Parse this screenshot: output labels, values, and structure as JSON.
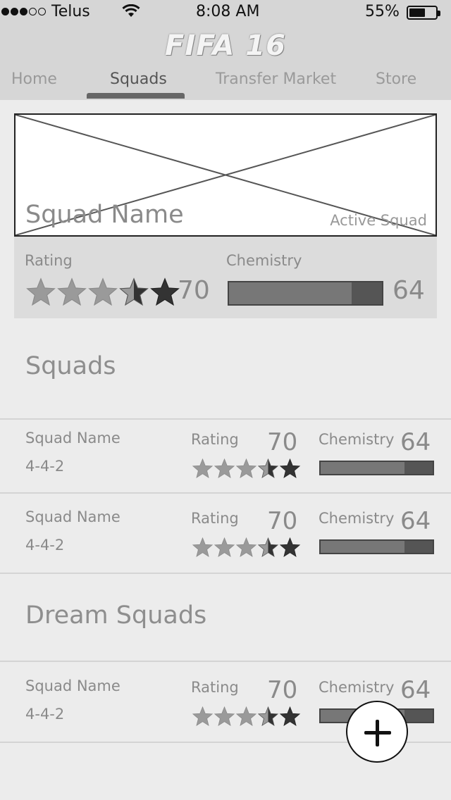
{
  "status_bar": {
    "carrier": "Telus",
    "time": "8:08 AM",
    "battery": "55%",
    "battery_level": 0.55,
    "signal_bars": 3,
    "signal_total": 5
  },
  "header": {
    "logo": "FIFA 16",
    "tabs": [
      {
        "label": "Home"
      },
      {
        "label": "Squads"
      },
      {
        "label": "Transfer Market"
      },
      {
        "label": "Store"
      }
    ],
    "active_tab": "Squads"
  },
  "active_squad": {
    "name": "Squad Name",
    "badge": "Active Squad",
    "rating_label": "Rating",
    "rating": "70",
    "stars": 3.5,
    "chemistry_label": "Chemistry",
    "chemistry": "64",
    "chemistry_fraction": 0.8
  },
  "squads_section": {
    "title": "Squads",
    "items": [
      {
        "name": "Squad Name",
        "formation": "4-4-2",
        "rating_label": "Rating",
        "rating": "70",
        "stars": 3.5,
        "chemistry_label": "Chemistry",
        "chemistry": "64",
        "chemistry_fraction": 0.75
      },
      {
        "name": "Squad Name",
        "formation": "4-4-2",
        "rating_label": "Rating",
        "rating": "70",
        "stars": 3.5,
        "chemistry_label": "Chemistry",
        "chemistry": "64",
        "chemistry_fraction": 0.75
      }
    ]
  },
  "dream_section": {
    "title": "Dream Squads",
    "items": [
      {
        "name": "Squad Name",
        "formation": "4-4-2",
        "rating_label": "Rating",
        "rating": "70",
        "stars": 3.5,
        "chemistry_label": "Chemistry",
        "chemistry": "64",
        "chemistry_fraction": 0.75
      }
    ]
  },
  "fab": {
    "icon": "plus-icon"
  }
}
